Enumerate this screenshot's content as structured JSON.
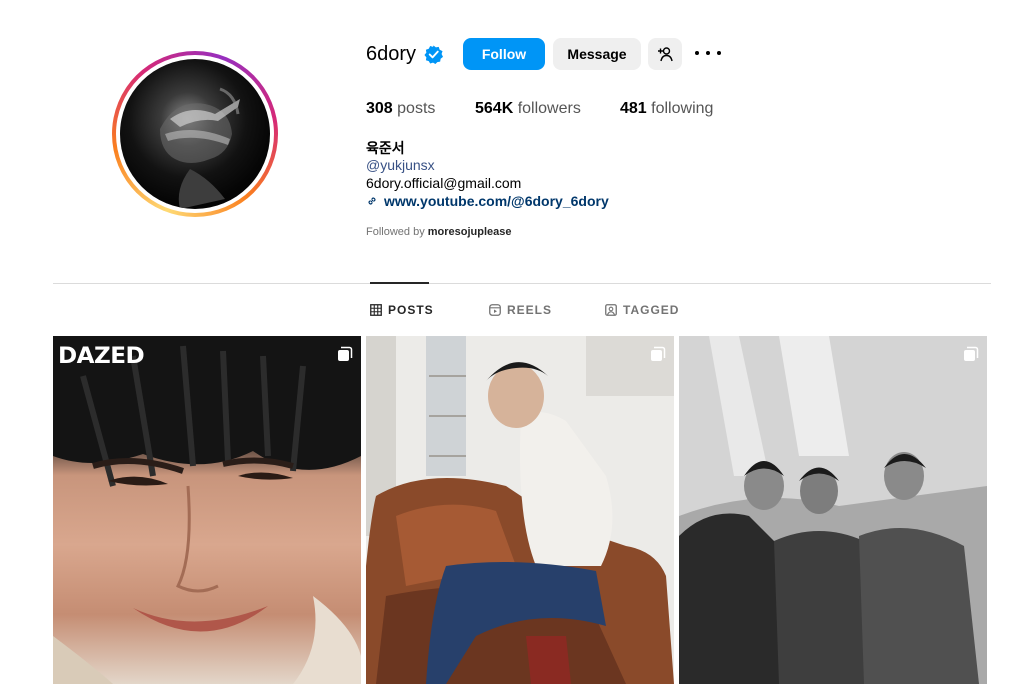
{
  "profile": {
    "username": "6dory",
    "verified_icon": "verified-badge-icon",
    "follow_label": "Follow",
    "message_label": "Message",
    "suggest_icon": "add-person-icon",
    "more_icon": "more-options-icon"
  },
  "stats": {
    "posts_count": "308",
    "posts_label": "posts",
    "followers_count": "564K",
    "followers_label": "followers",
    "following_count": "481",
    "following_label": "following"
  },
  "bio": {
    "full_name": "육준서",
    "handle": "@yukjunsx",
    "email": "6dory.official@gmail.com",
    "link": "www.youtube.com/@6dory_6dory",
    "followed_by_prefix": "Followed by",
    "followed_by_user": "moresojuplease"
  },
  "tabs": [
    {
      "label": "POSTS",
      "icon": "grid-icon",
      "active": true
    },
    {
      "label": "REELS",
      "icon": "reels-icon",
      "active": false
    },
    {
      "label": "TAGGED",
      "icon": "tagged-icon",
      "active": false
    }
  ],
  "posts": [
    {
      "overlay_text": "DAZED",
      "icon": "multiple-images-icon"
    },
    {
      "icon": "multiple-images-icon"
    },
    {
      "icon": "multiple-images-icon"
    }
  ],
  "colors": {
    "follow_button": "#0095f6",
    "secondary_button": "#efefef",
    "link": "#00376b",
    "verified": "#0095f6"
  }
}
